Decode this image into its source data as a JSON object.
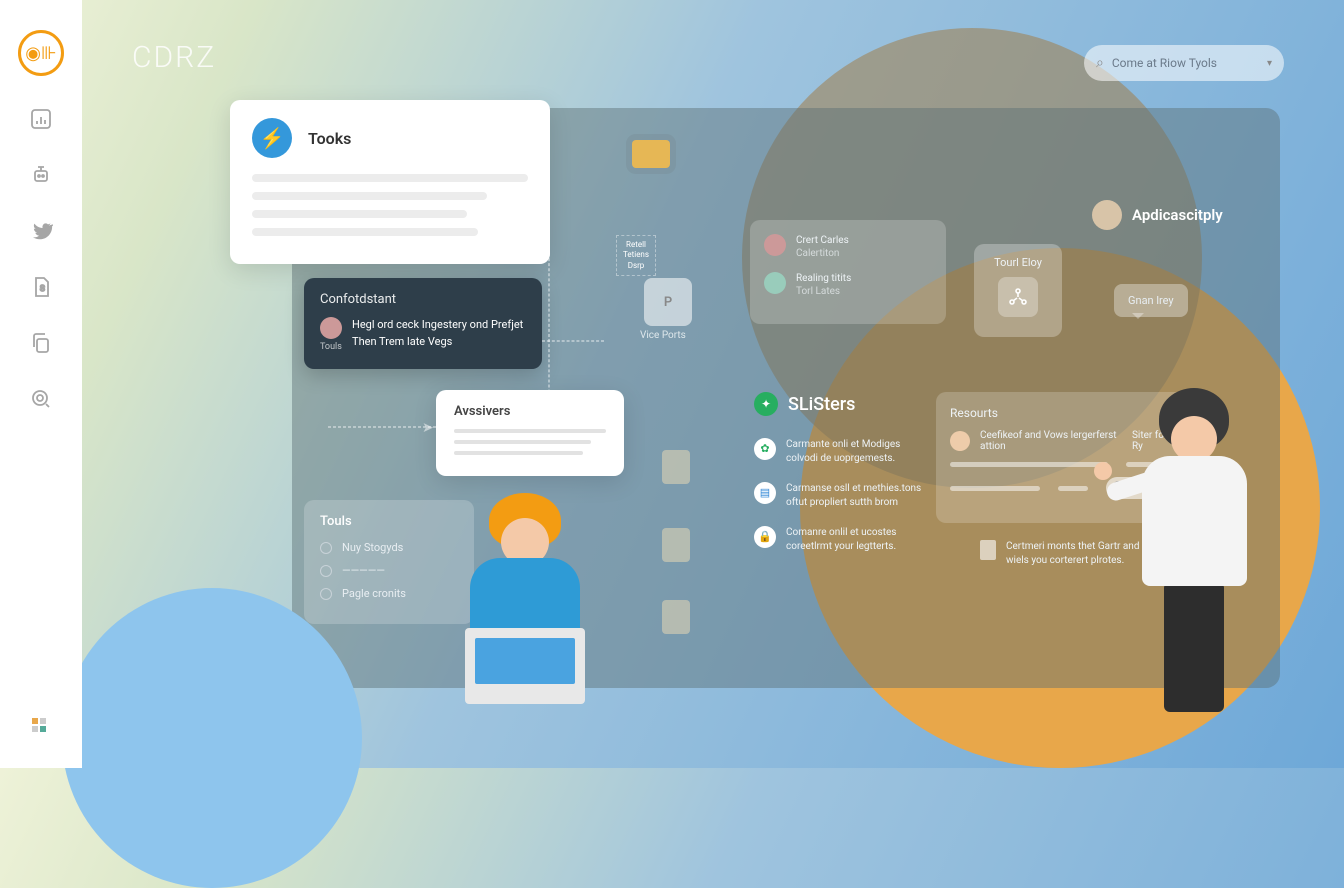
{
  "brand": "CDRZ",
  "search": {
    "placeholder": "Come at Riow Tyols"
  },
  "sidebar": {
    "icons": [
      "chart",
      "robot",
      "network",
      "twitter",
      "doc",
      "copy",
      "zoom"
    ],
    "bottom": "grid"
  },
  "tools_card": {
    "title": "Tooks"
  },
  "confidstant": {
    "title": "Confotdstant",
    "avatar_label": "Touls",
    "text": "Hegl ord ceck Ingestery ond Prefjet Then Trem late Vegs"
  },
  "answers": {
    "title": "Avssivers"
  },
  "tools_list": {
    "title": "Touls",
    "items": [
      "Nuy Stogyds",
      "",
      "Pagle cronits"
    ]
  },
  "retell": {
    "text": "Retell Tetiens Dsrp"
  },
  "p_label": "P",
  "vice": "Vice Ports",
  "people": {
    "p1": {
      "name": "Crert Carles",
      "sub": "Calertiton"
    },
    "p2": {
      "name": "Realing titits",
      "sub": "Torl Lates"
    }
  },
  "toolbox": {
    "title": "Tourl Eloy"
  },
  "apdic": {
    "label": "Apdicascitply"
  },
  "bubble": {
    "text": "Gnan lrey"
  },
  "susters": {
    "title": "SLiSters",
    "items": [
      "Carmante onli et Modiges colvodi de uoprgemests.",
      "Carmanse osll et methies.tons oftut propliert sutth brom",
      "Comanre onlil et ucostes coreetlrmt your legtterts."
    ]
  },
  "resources": {
    "title": "Resourts",
    "row1": {
      "name": "Ceefikeof and Vows lergerferst attion"
    },
    "pill": "Siter for Ry",
    "toggle": "7)"
  },
  "tip": {
    "text": "Certmeri monts thet Gartr and wiels you corterert plrotes."
  },
  "folder_icon": "folder"
}
